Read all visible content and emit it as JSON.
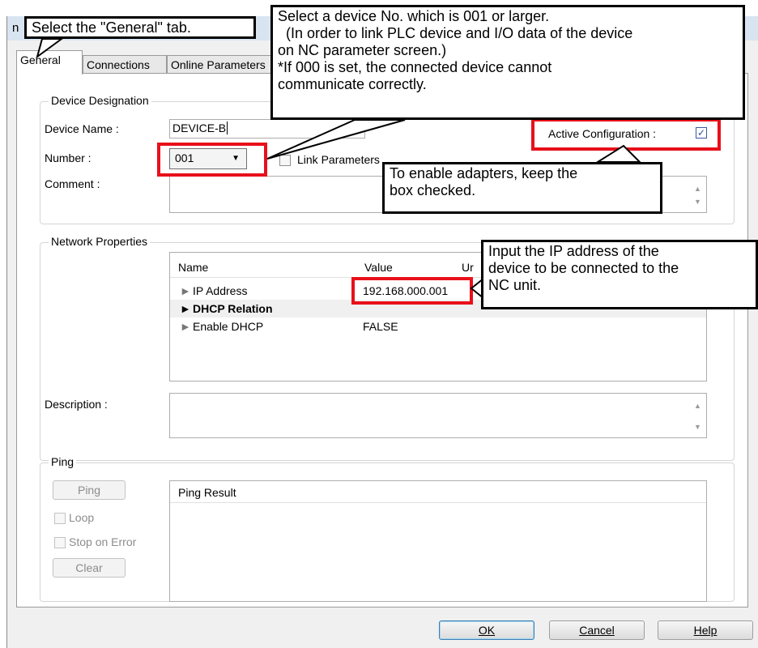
{
  "window": {
    "title_fragment": "n"
  },
  "tabs": [
    {
      "label": "General",
      "active": true
    },
    {
      "label": "Connections",
      "active": false
    },
    {
      "label": "Online Parameters",
      "active": false
    }
  ],
  "device_designation": {
    "legend": "Device Designation",
    "device_name_label": "Device Name :",
    "device_name_value": "DEVICE-B",
    "number_label": "Number :",
    "number_value": "001",
    "link_parameters_label": "Link Parameters",
    "link_parameters_checked": false,
    "active_configuration_label": "Active Configuration :",
    "active_configuration_checked": true,
    "comment_label": "Comment :"
  },
  "network_properties": {
    "legend": "Network Properties",
    "columns": [
      "Name",
      "Value",
      "Ur"
    ],
    "rows": [
      {
        "name": "IP Address",
        "value": "192.168.000.001",
        "section": false
      },
      {
        "name": "DHCP Relation",
        "value": "",
        "section": true
      },
      {
        "name": "Enable DHCP",
        "value": "FALSE",
        "section": false
      }
    ],
    "description_label": "Description :"
  },
  "ping": {
    "legend": "Ping",
    "ping_button": "Ping",
    "loop_label": "Loop",
    "stop_on_error_label": "Stop on Error",
    "clear_button": "Clear",
    "result_header": "Ping Result"
  },
  "footer": {
    "ok": "OK",
    "cancel": "Cancel",
    "help": "Help"
  },
  "callouts": {
    "general_tab": "Select the \"General\" tab.",
    "device_number": [
      "Select a device No. which is 001 or larger.",
      "(In order to link PLC device and I/O data of the device",
      "on NC parameter screen.)",
      "*If 000 is set, the connected device cannot",
      "communicate correctly."
    ],
    "active_config": [
      "To enable adapters, keep the",
      "box checked."
    ],
    "ip_address": [
      "Input the IP address of the",
      "device to be connected to the",
      "NC unit."
    ]
  },
  "colors": {
    "highlight": "#e8101a",
    "checkbox_accent": "#2c4f9c"
  }
}
